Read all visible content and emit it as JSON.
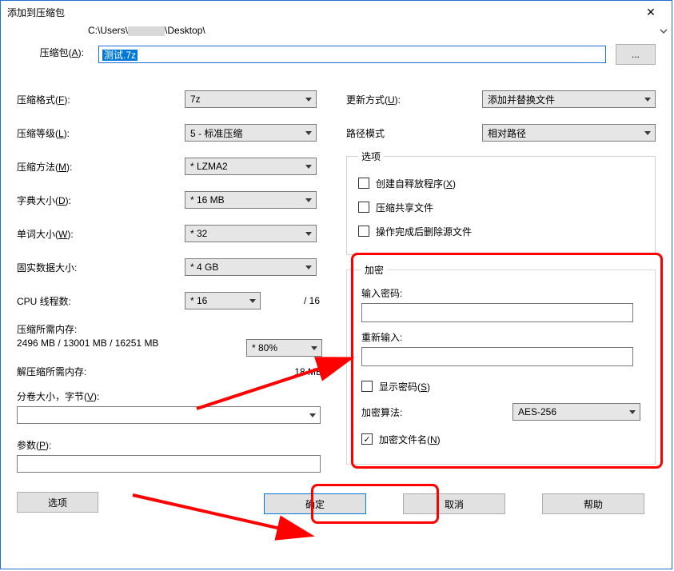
{
  "title": "添加到压缩包",
  "archive": {
    "label": "压缩包(A):",
    "path_prefix": "C:\\Users\\",
    "path_suffix": "\\Desktop\\",
    "filename": "测试.7z",
    "browse": "..."
  },
  "left": {
    "format_label": "压缩格式(F):",
    "format_value": "7z",
    "level_label": "压缩等级(L):",
    "level_value": "5 - 标准压缩",
    "method_label": "压缩方法(M):",
    "method_value": "* LZMA2",
    "dict_label": "字典大小(D):",
    "dict_value": "* 16 MB",
    "word_label": "单词大小(W):",
    "word_value": "* 32",
    "solid_label": "固实数据大小:",
    "solid_value": "* 4 GB",
    "threads_label": "CPU 线程数:",
    "threads_value": "* 16",
    "threads_total": "/ 16",
    "comp_mem_label": "压缩所需内存:",
    "comp_mem_value": "2496 MB / 13001 MB / 16251 MB",
    "comp_mem_pct": "* 80%",
    "decomp_mem_label": "解压缩所需内存:",
    "decomp_mem_value": "18 MB",
    "volume_label": "分卷大小，字节(V):",
    "params_label": "参数(P):",
    "options_btn": "选项"
  },
  "right": {
    "update_label": "更新方式(U):",
    "update_value": "添加并替换文件",
    "path_mode_label": "路径模式",
    "path_mode_value": "相对路径",
    "options_legend": "选项",
    "sfx_label": "创建自释放程序(X)",
    "shared_label": "压缩共享文件",
    "delete_label": "操作完成后删除源文件",
    "enc_legend": "加密",
    "pw_label": "输入密码:",
    "pw2_label": "重新输入:",
    "show_pw_label": "显示密码(S)",
    "enc_method_label": "加密算法:",
    "enc_method_value": "AES-256",
    "enc_names_label": "加密文件名(N)"
  },
  "buttons": {
    "ok": "确定",
    "cancel": "取消",
    "help": "帮助"
  }
}
